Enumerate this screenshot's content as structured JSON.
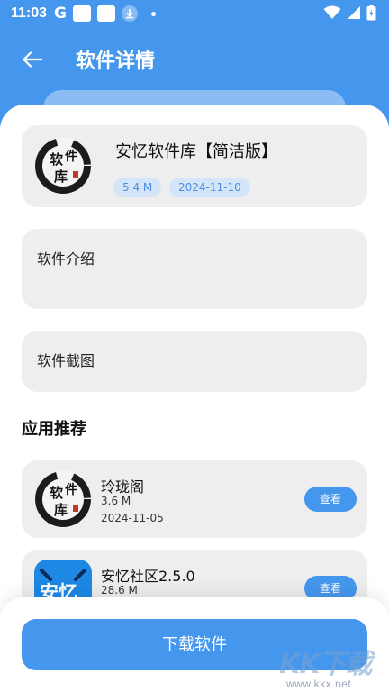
{
  "status_bar": {
    "time": "11:03",
    "g_label": "G",
    "icons": [
      "google-icon",
      "app-notification-icon",
      "app-notification-icon",
      "download-icon",
      "dot-icon",
      "wifi-icon",
      "signal-icon",
      "battery-icon"
    ]
  },
  "header": {
    "title": "软件详情",
    "back_icon": "arrow-left-icon"
  },
  "app": {
    "name": "安忆软件库【简洁版】",
    "size": "5.4 M",
    "date": "2024-11-10",
    "logo_text": [
      "软",
      "件",
      "库"
    ]
  },
  "sections": {
    "intro_label": "软件介绍",
    "screenshots_label": "软件截图"
  },
  "recommend": {
    "title": "应用推荐",
    "items": [
      {
        "name": "玲珑阁",
        "size": "3.6 M",
        "date": "2024-11-05",
        "button": "查看"
      },
      {
        "name": "安忆社区2.5.0",
        "size": "28.6 M",
        "date": "",
        "button": "查看",
        "logo_text": "安忆"
      }
    ]
  },
  "footer": {
    "download_label": "下载软件"
  },
  "watermark": {
    "brand": "KK下载",
    "url": "www.kkx.net"
  },
  "colors": {
    "primary": "#4597ee",
    "card_bg": "#eeeeee",
    "badge_bg": "#d4e5f9",
    "badge_text": "#4a8fe0"
  }
}
